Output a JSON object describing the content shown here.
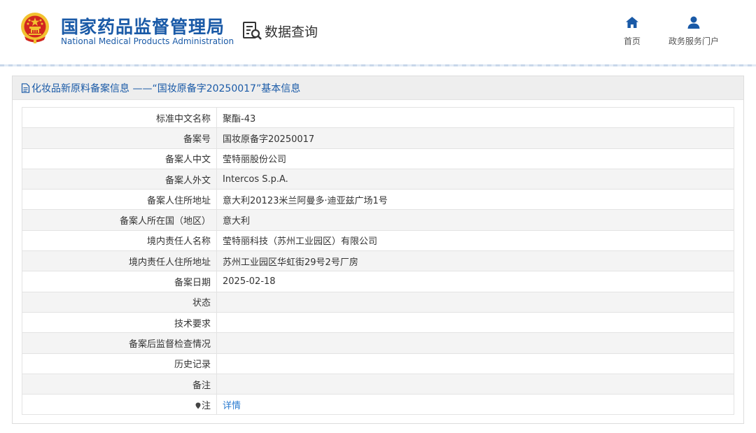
{
  "header": {
    "org_cn": "国家药品监督管理局",
    "org_en": "National Medical Products Administration",
    "data_query": "数据查询",
    "nav": [
      {
        "label": "首页",
        "icon": "home-icon"
      },
      {
        "label": "政务服务门户",
        "icon": "user-icon"
      }
    ]
  },
  "panel": {
    "title": "化妆品新原料备案信息 ——“国妆原备字20250017”基本信息",
    "icon": "document-icon"
  },
  "rows": [
    {
      "key": "标准中文名称",
      "value": "聚酯-43"
    },
    {
      "key": "备案号",
      "value": "国妆原备字20250017"
    },
    {
      "key": "备案人中文",
      "value": "莹特丽股份公司"
    },
    {
      "key": "备案人外文",
      "value": "Intercos S.p.A."
    },
    {
      "key": "备案人住所地址",
      "value": "意大利20123米兰阿曼多·迪亚兹广场1号"
    },
    {
      "key": "备案人所在国（地区）",
      "value": "意大利"
    },
    {
      "key": "境内责任人名称",
      "value": "莹特丽科技（苏州工业园区）有限公司"
    },
    {
      "key": "境内责任人住所地址",
      "value": "苏州工业园区华虹街29号2号厂房"
    },
    {
      "key": "备案日期",
      "value": "2025-02-18"
    },
    {
      "key": "状态",
      "value": ""
    },
    {
      "key": "技术要求",
      "value": ""
    },
    {
      "key": "备案后监督检查情况",
      "value": ""
    },
    {
      "key": "历史记录",
      "value": ""
    },
    {
      "key": "备注",
      "value": ""
    },
    {
      "key": "注",
      "value": "详情"
    }
  ],
  "colors": {
    "brand_blue": "#1a5aa7",
    "link_blue": "#2a7bd0",
    "emblem_red": "#d2261f",
    "emblem_gold": "#f2c230"
  }
}
